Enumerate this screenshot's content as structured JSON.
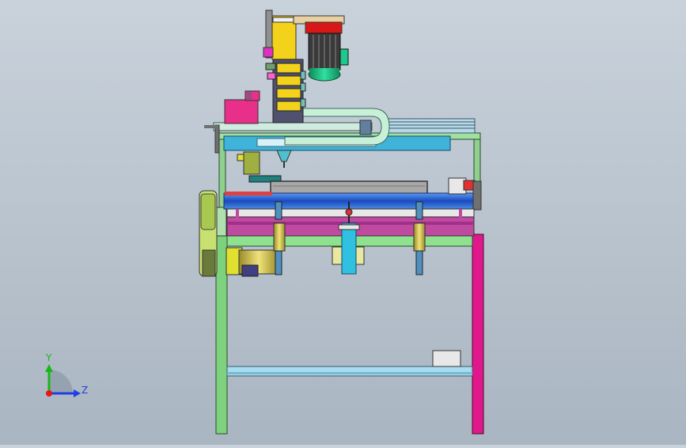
{
  "viewport": {
    "background_top": "#c9d2db",
    "background_bottom": "#a9b5c1"
  },
  "triad": {
    "y_label": "Y",
    "z_label": "Z",
    "y_color": "#18b818",
    "z_color": "#2040e0",
    "origin_color": "#e01818"
  },
  "colors": {
    "frame_green": "#7ed27e",
    "frame_magenta": "#e0188c",
    "beam_cyan": "#3fb3d9",
    "table_magenta": "#c04aa0",
    "yellow": "#f2d21a",
    "motor_green": "#1ec88c",
    "pink_box": "#e8308a",
    "panel_gray": "#a8a8a8",
    "blue_bar": "#2a6ad8"
  },
  "icons": {
    "orientation_triad": "axis-triad-icon"
  }
}
